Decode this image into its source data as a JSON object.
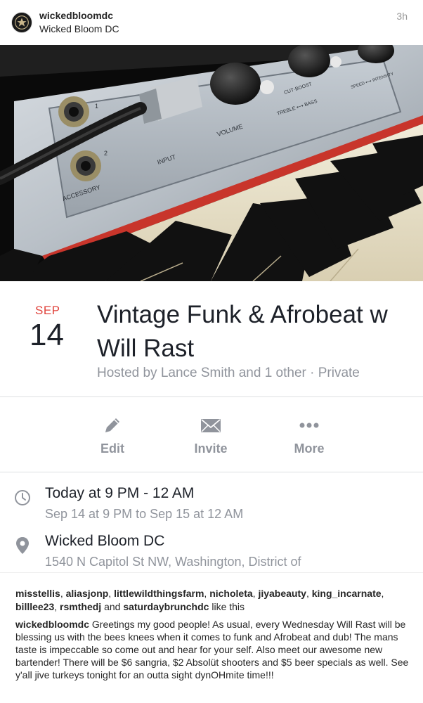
{
  "post": {
    "username": "wickedbloomdc",
    "location": "Wicked Bloom DC",
    "time_ago": "3h",
    "avatar_icon": "bloom-logo-icon"
  },
  "event": {
    "month": "SEP",
    "day": "14",
    "title": "Vintage Funk & Afrobeat w Will Rast",
    "host_line": "Hosted by Lance Smith and 1 other · Private",
    "cover_panel_labels": {
      "accessory": "ACCESSORY",
      "input": "INPUT",
      "volume": "VOLUME",
      "treble_bass": "TREBLE ⟷ BASS",
      "cut_boost": "CUT·BOOST",
      "speed_intensity": "SPEED ⟷ INTENSITY",
      "jack_1": "1",
      "jack_2": "2"
    },
    "actions": [
      {
        "label": "Edit",
        "icon": "pencil-icon"
      },
      {
        "label": "Invite",
        "icon": "envelope-icon"
      },
      {
        "label": "More",
        "icon": "more-dots-icon"
      }
    ],
    "time_main": "Today at 9 PM - 12 AM",
    "time_sub": "Sep 14 at 9 PM to Sep 15 at 12 AM",
    "location_name": "Wicked Bloom DC",
    "location_address": "1540 N Capitol St NW, Washington, District of"
  },
  "likes": {
    "users": [
      "misstellis",
      "aliasjonp",
      "littlewildthingsfarm",
      "nicholeta",
      "jiyabeauty",
      "king_incarnate",
      "billlee23",
      "rsmthedj"
    ],
    "and_word": "and",
    "last_user": "saturdaybrunchdc",
    "suffix": "like this"
  },
  "caption": {
    "username": "wickedbloomdc",
    "text": "Greetings my good people! As usual, every Wednesday Will Rast will be blessing us with the bees knees when it comes to funk and Afrobeat and dub! The mans taste is impeccable so come out and hear for your self. Also meet our awesome new bartender! There will be $6 sangria, $2 Absolüt shooters and $5 beer specials as well. See y'all jive turkeys tonight for an outta sight dynOHmite time!!!"
  },
  "colors": {
    "month_red": "#e0423b",
    "secondary_gray": "#90949c",
    "primary_text": "#1d2129"
  }
}
